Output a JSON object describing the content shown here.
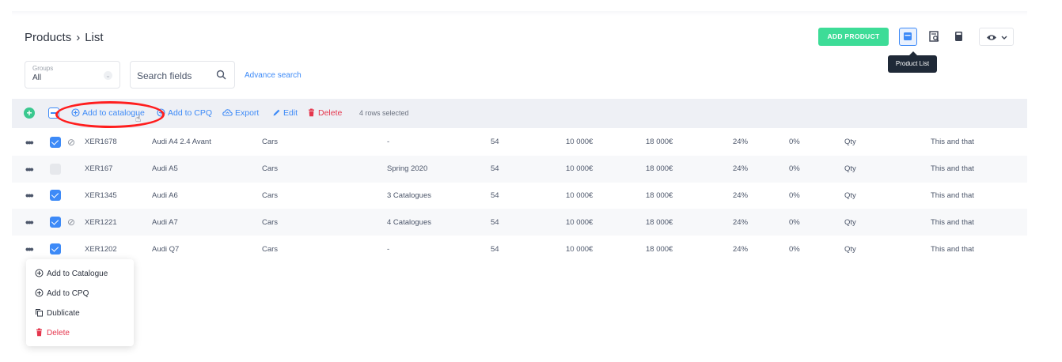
{
  "breadcrumb": {
    "section": "Products",
    "separator": "›",
    "page": "List"
  },
  "filters": {
    "groups_label": "Groups",
    "groups_value": "All",
    "search_placeholder": "Search fields",
    "advance_search": "Advance search"
  },
  "header_actions": {
    "add_product": "ADD PRODUCT",
    "tooltip": "Product List"
  },
  "toolbar": {
    "add_to_catalogue": "Add to catalogue",
    "add_to_cpq": "Add to CPQ",
    "export": "Export",
    "edit": "Edit",
    "delete": "Delete",
    "selection_count": "4 rows selected"
  },
  "rows": [
    {
      "checked": true,
      "attachment": true,
      "sku": "XER1678",
      "name": "Audi A4 2.4 Avant",
      "category": "Cars",
      "catalogue": "-",
      "catalogue_link": false,
      "qty": "54",
      "price1": "10 000€",
      "price2": "18 000€",
      "pct1": "24%",
      "pct2": "0%",
      "unit": "Qty",
      "note": "This and that"
    },
    {
      "checked": false,
      "attachment": false,
      "sku": "XER167",
      "name": "Audi A5",
      "category": "Cars",
      "catalogue": "Spring 2020",
      "catalogue_link": false,
      "qty": "54",
      "price1": "10 000€",
      "price2": "18 000€",
      "pct1": "24%",
      "pct2": "0%",
      "unit": "Qty",
      "note": "This and that"
    },
    {
      "checked": true,
      "attachment": false,
      "sku": "XER1345",
      "name": "Audi A6",
      "category": "Cars",
      "catalogue": "3 Catalogues",
      "catalogue_link": true,
      "qty": "54",
      "price1": "10 000€",
      "price2": "18 000€",
      "pct1": "24%",
      "pct2": "0%",
      "unit": "Qty",
      "note": "This and that"
    },
    {
      "checked": true,
      "attachment": true,
      "sku": "XER1221",
      "name": "Audi A7",
      "category": "Cars",
      "catalogue": "4 Catalogues",
      "catalogue_link": true,
      "qty": "54",
      "price1": "10 000€",
      "price2": "18 000€",
      "pct1": "24%",
      "pct2": "0%",
      "unit": "Qty",
      "note": "This and that"
    },
    {
      "checked": true,
      "attachment": false,
      "sku": "XER1202",
      "name": "Audi Q7",
      "category": "Cars",
      "catalogue": "-",
      "catalogue_link": false,
      "qty": "54",
      "price1": "10 000€",
      "price2": "18 000€",
      "pct1": "24%",
      "pct2": "0%",
      "unit": "Qty",
      "note": "This and that"
    }
  ],
  "row_menu": {
    "add_to_catalogue": "Add to Catalogue",
    "add_to_cpq": "Add to CPQ",
    "duplicate": "Dublicate",
    "delete": "Delete"
  },
  "colors": {
    "accent": "#3d8af7",
    "success": "#3ddc97",
    "danger": "#e5364d",
    "highlight_ring": "#ff1e1e"
  }
}
